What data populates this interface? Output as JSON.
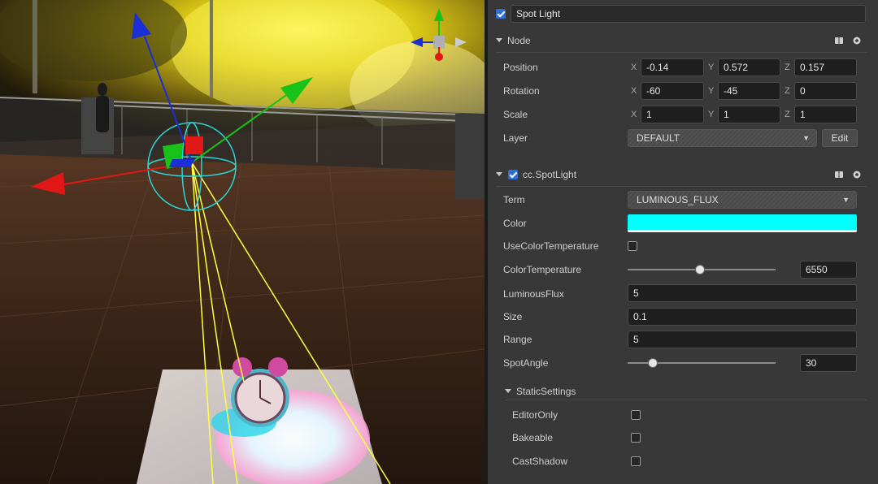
{
  "node_name": "Spot Light",
  "node_enabled": true,
  "node_section": {
    "title": "Node",
    "position": {
      "label": "Position",
      "x_label": "X",
      "x": "-0.14",
      "y_label": "Y",
      "y": "0.572",
      "z_label": "Z",
      "z": "0.157"
    },
    "rotation": {
      "label": "Rotation",
      "x_label": "X",
      "x": "-60",
      "y_label": "Y",
      "y": "-45",
      "z_label": "Z",
      "z": "0"
    },
    "scale": {
      "label": "Scale",
      "x_label": "X",
      "x": "1",
      "y_label": "Y",
      "y": "1",
      "z_label": "Z",
      "z": "1"
    },
    "layer": {
      "label": "Layer",
      "value": "DEFAULT",
      "edit_label": "Edit"
    }
  },
  "spotlight": {
    "title": "cc.SpotLight",
    "enabled": true,
    "term": {
      "label": "Term",
      "value": "LUMINOUS_FLUX"
    },
    "color": {
      "label": "Color",
      "value": "#00FFFF"
    },
    "use_color_temperature": {
      "label": "UseColorTemperature",
      "checked": false
    },
    "color_temperature": {
      "label": "ColorTemperature",
      "value": "6550",
      "slider_fraction": 0.49
    },
    "luminous_flux": {
      "label": "LuminousFlux",
      "value": "5"
    },
    "size": {
      "label": "Size",
      "value": "0.1"
    },
    "range": {
      "label": "Range",
      "value": "5"
    },
    "spot_angle": {
      "label": "SpotAngle",
      "value": "30",
      "slider_fraction": 0.17
    },
    "static_settings": {
      "title": "StaticSettings",
      "editor_only": {
        "label": "EditorOnly",
        "checked": false
      },
      "bakeable": {
        "label": "Bakeable",
        "checked": false
      },
      "cast_shadow": {
        "label": "CastShadow",
        "checked": false
      }
    }
  },
  "icons": {
    "book": "book-icon",
    "gear": "gear-icon",
    "collapse": "triangle-down-icon"
  },
  "colors": {
    "panel_bg": "#383838",
    "accent_blue": "#2f6fd6",
    "light_color": "#00ffff",
    "gizmo_x": "#e01818",
    "gizmo_y": "#19c219",
    "gizmo_z": "#1a2fd6"
  }
}
